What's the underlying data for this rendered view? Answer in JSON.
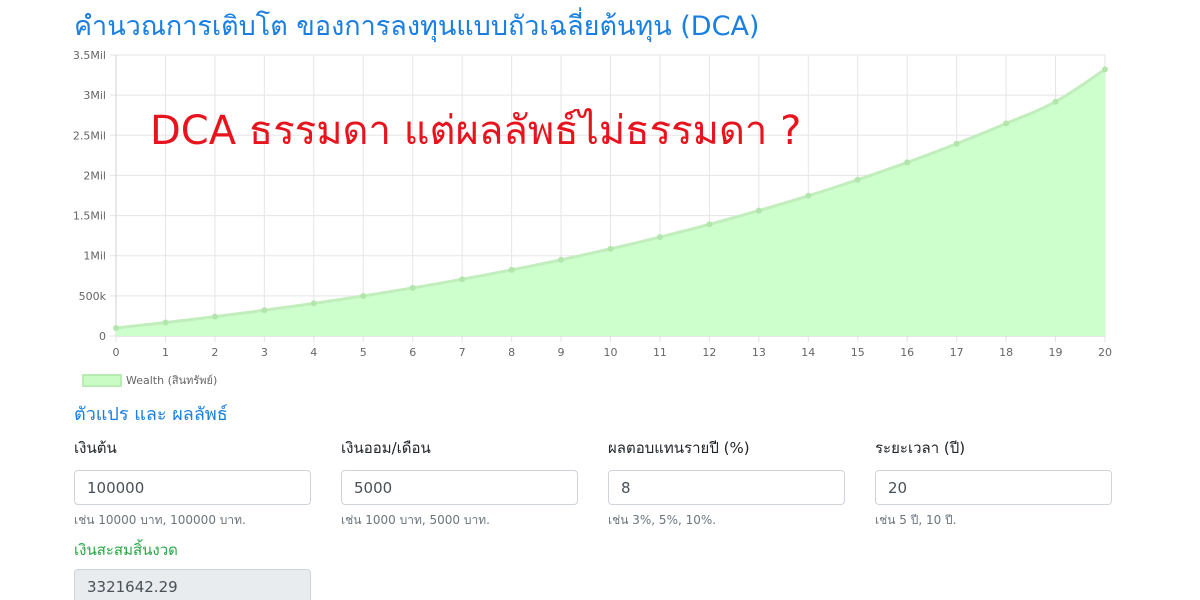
{
  "page": {
    "title": "คำนวณการเติบโต ของการลงทุนแบบถัวเฉลี่ยต้นทุน (DCA)",
    "headline": "DCA ธรรมดา แต่ผลลัพธ์ไม่ธรรมดา ?"
  },
  "chart_data": {
    "type": "area",
    "x": [
      0,
      1,
      2,
      3,
      4,
      5,
      6,
      7,
      8,
      9,
      10,
      11,
      12,
      13,
      14,
      15,
      16,
      17,
      18,
      19,
      20
    ],
    "series": [
      {
        "name": "Wealth (สินทรัพย์)",
        "values": [
          100000,
          168000,
          241440,
          320755,
          406415,
          498928,
          598842,
          706749,
          823289,
          949152,
          1085084,
          1231891,
          1390442,
          1561677,
          1746611,
          1946340,
          2162048,
          2395012,
          2646613,
          2918342,
          3321642
        ]
      }
    ],
    "y_ticks": [
      "0",
      "500k",
      "1Mil",
      "1.5Mil",
      "2Mil",
      "2.5Mil",
      "3Mil",
      "3.5Mil"
    ],
    "ylim": [
      0,
      3500000
    ],
    "xlim": [
      0,
      20
    ],
    "grid": true,
    "legend_position": "bottom-left",
    "colors": {
      "fill": "#ccffcc",
      "line": "#c2edbd",
      "point": "#b3e6ac"
    }
  },
  "section": {
    "title": "ตัวแปร และ ผลลัพธ์"
  },
  "fields": {
    "principal": {
      "label": "เงินต้น",
      "value": "100000",
      "help": "เช่น 10000 บาท, 100000 บาท."
    },
    "monthly": {
      "label": "เงินออม/เดือน",
      "value": "5000",
      "help": "เช่น 1000 บาท, 5000 บาท."
    },
    "rate": {
      "label": "ผลตอบแทนรายปี (%)",
      "value": "8",
      "help": "เช่น 3%, 5%, 10%."
    },
    "years": {
      "label": "ระยะเวลา (ปี)",
      "value": "20",
      "help": "เช่น 5 ปี, 10 ปี."
    }
  },
  "result": {
    "label": "เงินสะสมสิ้นงวด",
    "value": "3321642.29"
  },
  "colors": {
    "accent": "#1a7fe0",
    "headline": "#e8141d",
    "result_label": "#28a745"
  }
}
